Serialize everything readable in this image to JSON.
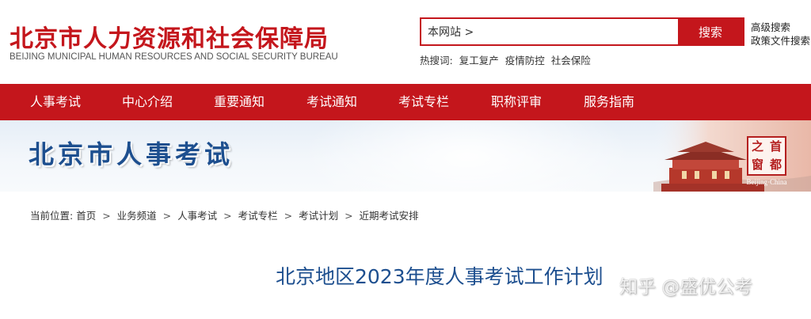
{
  "header": {
    "title": "北京市人力资源和社会保障局",
    "subtitle": "BEIJING MUNICIPAL HUMAN RESOURCES AND SOCIAL SECURITY BUREAU"
  },
  "search": {
    "scope_value": "本网站 >",
    "button_label": "搜索",
    "advanced_label": "高级搜索",
    "policy_label": "政策文件搜索",
    "hot_label": "热搜词:",
    "hot_terms": [
      "复工复产",
      "疫情防控",
      "社会保险"
    ]
  },
  "nav": {
    "items": [
      "人事考试",
      "中心介绍",
      "重要通知",
      "考试通知",
      "考试专栏",
      "职称评审",
      "服务指南"
    ]
  },
  "banner": {
    "title": "北京市人事考试",
    "seal_chars": [
      "之",
      "首",
      "窗",
      "都"
    ],
    "seal_caption": "Beijing·China"
  },
  "breadcrumb": {
    "label": "当前位置:",
    "items": [
      "首页",
      "业务频道",
      "人事考试",
      "考试专栏",
      "考试计划",
      "近期考试安排"
    ],
    "separator": ">"
  },
  "article": {
    "title": "北京地区2023年度人事考试工作计划"
  },
  "watermark": "知乎 @盛优公考",
  "colors": {
    "brand_red": "#c4161c",
    "title_blue": "#1d4f8f"
  }
}
